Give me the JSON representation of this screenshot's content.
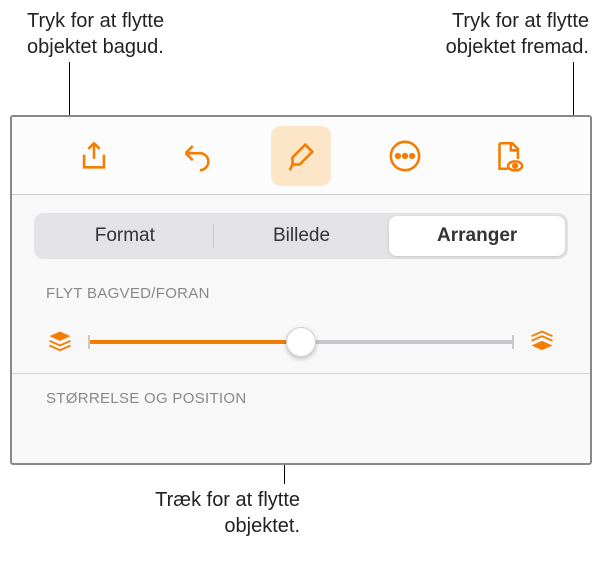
{
  "callouts": {
    "back": "Tryk for at flytte objektet bagud.",
    "forward": "Tryk for at flytte objektet fremad.",
    "drag": "Træk for at flytte objektet."
  },
  "toolbar": {
    "share": "share",
    "undo": "undo",
    "brush": "brush",
    "more": "more",
    "document": "document"
  },
  "tabs": {
    "format": "Format",
    "billede": "Billede",
    "arranger": "Arranger"
  },
  "sections": {
    "flyt": "FLYT BAGVED/FORAN",
    "size": "STØRRELSE OG POSITION"
  }
}
